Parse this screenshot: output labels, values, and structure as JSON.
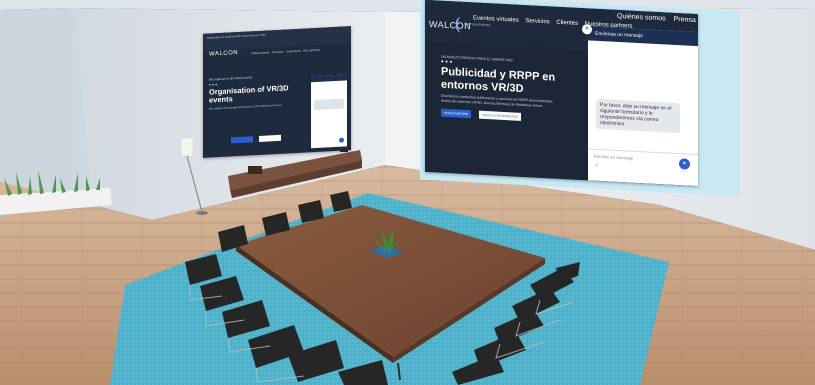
{
  "left_screen": {
    "logo": "WALCON",
    "top_line": "Organisation of virtual and 3D events from your office",
    "nav_links": "Virtual events · Services · Customers · Our partners",
    "hero_subtitle": "We organise in 3D virtual events",
    "hero_title": "Organisation of VR/3D events",
    "hero_description": "We organise and manage virtual events, 3D exhibitions and more",
    "button_primary": "",
    "button_secondary": ""
  },
  "right_screen": {
    "logo": "WALCON",
    "logo_sub": "VIRTUAL EVENTS",
    "nav_links": [
      "Eventos virtuales",
      "Servicios",
      "Clientes",
      "Nuestros partners"
    ],
    "nav_links_top": [
      "Quiénes somos",
      "Prensa"
    ],
    "hero_kicker": "UN NUEVO ESPACIO PARA EL MARKETING",
    "hero_title": "Publicidad y RRPP en entornos VR/3D",
    "hero_description": "Diseñamos campañas publicitarias y acciones de RRPP personalizadas dentro de entornos VR/3D. Nuevas fórmulas de Marketing Virtual.",
    "button_primary": "HAZTE PARTNER",
    "button_secondary": "SOLICITA INFORMACIÓN",
    "chat": {
      "header": "Envíenos un mensaje",
      "close_glyph": "×",
      "message": "Por favor, deje su mensaje en el siguiente formulario y le responderemos vía correo electrónico",
      "input_placeholder": "Escribe su mensaje",
      "emoji_glyph": "☺",
      "send_glyph": "➤"
    }
  },
  "colors": {
    "sky_blue_bg": "#1a3f8a",
    "wall": "#e6eaee",
    "floor": "#cfa98a",
    "rug": "#4fb1c9",
    "table": "#7a5038",
    "chair": "#2a2a2a",
    "screen_frame": "#c7e9f3",
    "accent": "#2c5fd0"
  }
}
